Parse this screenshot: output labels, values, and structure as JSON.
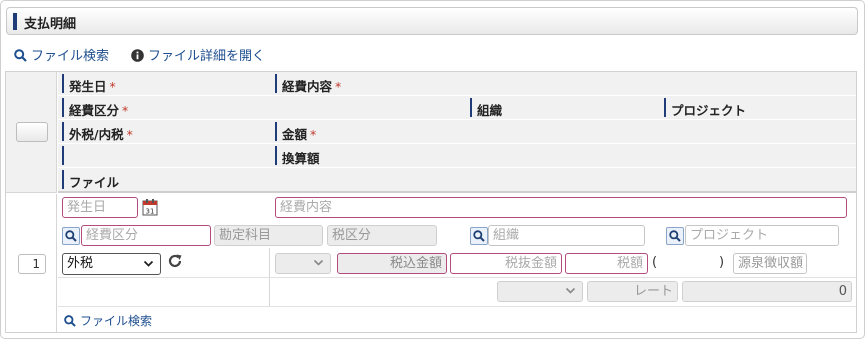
{
  "panel": {
    "title": "支払明細"
  },
  "top_links": {
    "file_search": "ファイル検索",
    "file_detail": "ファイル詳細を開く"
  },
  "headers": {
    "occurrence_date": "発生日",
    "expense_content": "経費内容",
    "expense_category": "経費区分",
    "organization": "組織",
    "project": "プロジェクト",
    "tax_type": "外税/内税",
    "amount": "金額",
    "converted_amount": "換算額",
    "file": "ファイル",
    "required_mark": "*"
  },
  "row": {
    "number": "1",
    "placeholders": {
      "occurrence_date": "発生日",
      "expense_content": "経費内容",
      "expense_category": "経費区分",
      "account_item": "勘定科目",
      "tax_category": "税区分",
      "organization": "組織",
      "project": "プロジェクト",
      "tax_included": "税込金額",
      "tax_excluded": "税抜金額",
      "tax": "税額",
      "withholding": "源泉徴収額",
      "rate": "レート"
    },
    "tax_type_value": "外税",
    "paren_open": "(",
    "paren_close": ")",
    "converted_value": "0",
    "file_search": "ファイル検索"
  },
  "colors": {
    "accent": "#1d3c78",
    "link": "#1e4f8f",
    "required": "#b44b7e",
    "calendar": "#c0392b"
  },
  "icons": {
    "search": "search-icon",
    "info": "info-icon",
    "calendar": "calendar-icon",
    "refresh": "refresh-icon",
    "dropdown": "chevron-down-icon"
  }
}
